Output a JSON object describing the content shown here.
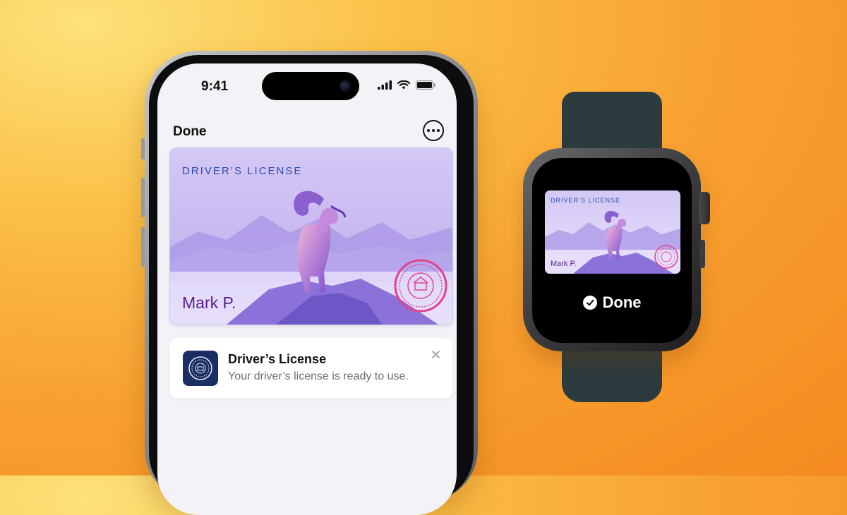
{
  "phone": {
    "status": {
      "time": "9:41"
    },
    "nav": {
      "done_label": "Done"
    },
    "card": {
      "title_light": "DRIVER’S",
      "title_bold": "LICENSE",
      "name": "Mark P."
    },
    "notification": {
      "title": "Driver’s License",
      "body": "Your driver’s license is ready to use.",
      "close_icon": "close-icon"
    }
  },
  "watch": {
    "card": {
      "title": "DRIVER’S LICENSE",
      "name": "Mark P."
    },
    "done_label": "Done"
  },
  "colors": {
    "background_warm": "#f8a030",
    "card_lavender": "#c9b8f0",
    "card_title_blue": "#2b4ea8",
    "card_name_purple": "#5a1f8a",
    "watch_band": "#2c3c3e",
    "seal_pink": "#e0458a"
  }
}
